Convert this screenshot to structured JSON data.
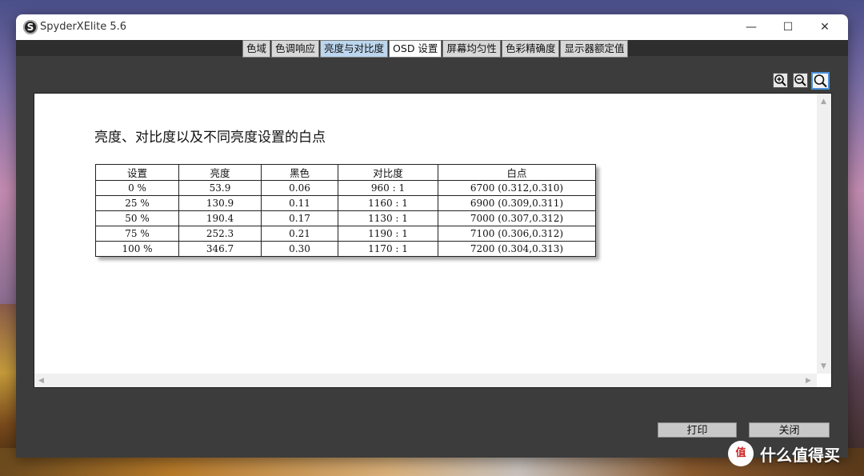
{
  "window": {
    "app_icon": "S",
    "title": "SpyderXElite 5.6",
    "minimize_glyph": "—",
    "maximize_glyph": "☐",
    "close_glyph": "✕"
  },
  "tabs": [
    {
      "label": "色域"
    },
    {
      "label": "色调响应"
    },
    {
      "label": "亮度与对比度"
    },
    {
      "label": "OSD 设置"
    },
    {
      "label": "屏幕均匀性"
    },
    {
      "label": "色彩精确度"
    },
    {
      "label": "显示器额定值"
    }
  ],
  "selected_tab": "亮度与对比度",
  "zoom": {
    "icons": [
      "zoom-in-icon",
      "zoom-out-icon",
      "zoom-fit-icon"
    ]
  },
  "report": {
    "title": "亮度、对比度以及不同亮度设置的白点",
    "columns": [
      "设置",
      "亮度",
      "黑色",
      "对比度",
      "白点"
    ],
    "rows": [
      [
        "0 %",
        "53.9",
        "0.06",
        "960  :  1",
        "6700 (0.312,0.310)"
      ],
      [
        "25 %",
        "130.9",
        "0.11",
        "1160  :  1",
        "6900 (0.309,0.311)"
      ],
      [
        "50 %",
        "190.4",
        "0.17",
        "1130  :  1",
        "7000 (0.307,0.312)"
      ],
      [
        "75 %",
        "252.3",
        "0.21",
        "1190  :  1",
        "7100 (0.306,0.312)"
      ],
      [
        "100 %",
        "346.7",
        "0.30",
        "1170  :  1",
        "7200 (0.304,0.313)"
      ]
    ]
  },
  "buttons": {
    "print": "打印",
    "close": "关闭"
  },
  "watermark": {
    "logo": "值",
    "text": "什么值得买"
  },
  "colors": {
    "window_bg": "#3c3c3c",
    "selected_tab": "#bcd6ee",
    "zoom_highlight": "#4a90d9"
  }
}
